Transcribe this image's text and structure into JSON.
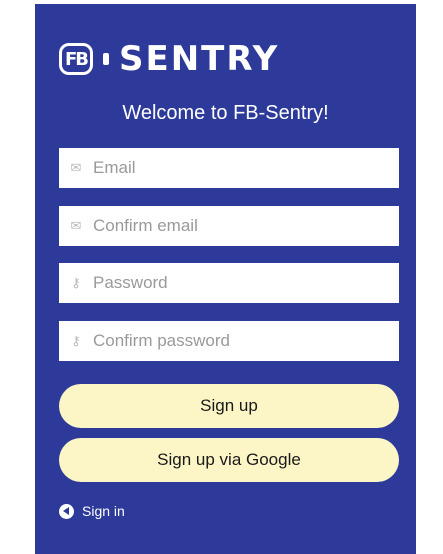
{
  "brand": {
    "logo_mark": "FB",
    "logo_text": "SENTRY",
    "panel_color": "#2d3a9a",
    "button_color": "#fcf5c6"
  },
  "header": {
    "welcome": "Welcome to FB-Sentry!"
  },
  "form": {
    "email": {
      "placeholder": "Email",
      "icon": "envelope-icon"
    },
    "confirm_email": {
      "placeholder": "Confirm email",
      "icon": "envelope-icon"
    },
    "password": {
      "placeholder": "Password",
      "icon": "key-icon"
    },
    "confirm_password": {
      "placeholder": "Confirm password",
      "icon": "key-icon"
    }
  },
  "actions": {
    "signup_label": "Sign up",
    "signup_google_label": "Sign up via Google",
    "signin_label": "Sign in"
  }
}
